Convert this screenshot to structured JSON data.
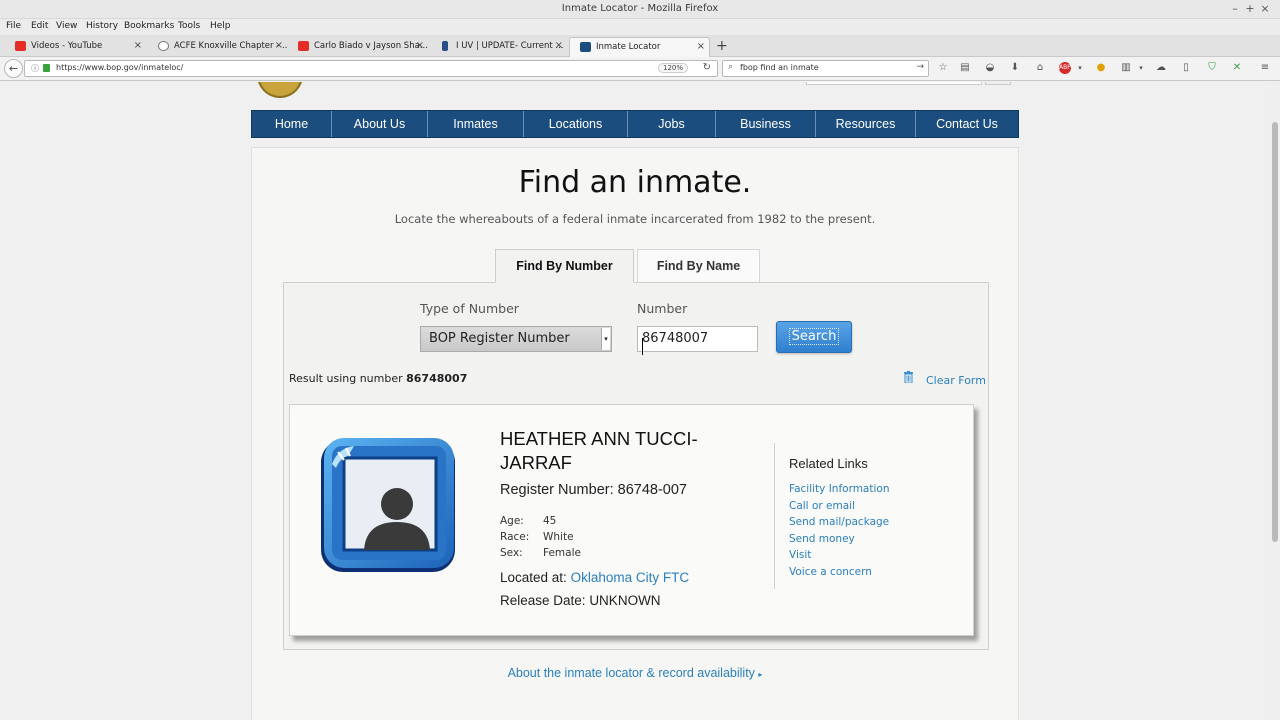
{
  "window": {
    "title": "Inmate Locator - Mozilla Firefox"
  },
  "menu": [
    "File",
    "Edit",
    "View",
    "History",
    "Bookmarks",
    "Tools",
    "Help"
  ],
  "tabs": [
    {
      "label": "Videos - YouTube",
      "icon": "youtube-icon",
      "color": "#e52d27"
    },
    {
      "label": "ACFE Knoxville Chapter - ...",
      "icon": "globe-icon",
      "color": "#777777"
    },
    {
      "label": "Carlo Biado v Jayson Sha...",
      "icon": "youtube-icon",
      "color": "#e52d27"
    },
    {
      "label": "I UV | UPDATE- Current ...",
      "icon": "site-icon",
      "color": "#2a4c8a"
    },
    {
      "label": "Inmate Locator",
      "icon": "bop-icon",
      "color": "#1b4d7e"
    }
  ],
  "navbar": {
    "url": "https://www.bop.gov/inmateloc/",
    "zoom": "120%",
    "search_value": "fbop find an inmate"
  },
  "site_nav": [
    "Home",
    "About Us",
    "Inmates",
    "Locations",
    "Jobs",
    "Business",
    "Resources",
    "Contact Us"
  ],
  "page": {
    "title": "Find an inmate.",
    "subtitle": "Locate the whereabouts of a federal inmate incarcerated from 1982 to the present.",
    "tab_number": "Find By Number",
    "tab_name": "Find By Name"
  },
  "form": {
    "type_label": "Type of Number",
    "type_value": "BOP Register Number",
    "number_label": "Number",
    "number_value": "86748007",
    "search_label": "Search",
    "result_prefix": "Result using number ",
    "result_number": "86748007",
    "clear_label": "Clear Form"
  },
  "inmate": {
    "name": "HEATHER ANN TUCCI-JARRAF",
    "register_label": "Register Number: ",
    "register_number": "86748-007",
    "age_label": "Age:",
    "age": "45",
    "race_label": "Race:",
    "race": "White",
    "sex_label": "Sex:",
    "sex": "Female",
    "located_label": "Located at: ",
    "location": "Oklahoma City FTC",
    "release_label": "Release Date: ",
    "release_date": "UNKNOWN"
  },
  "related": {
    "title": "Related Links",
    "links": [
      "Facility Information",
      "Call or email",
      "Send mail/package",
      "Send money",
      "Visit",
      "Voice a concern"
    ]
  },
  "about_link": "About the inmate locator & record availability",
  "colors": {
    "nav_bg": "#1b4d7e",
    "link": "#2a7fbe",
    "search_button": "#2f7fd0"
  }
}
